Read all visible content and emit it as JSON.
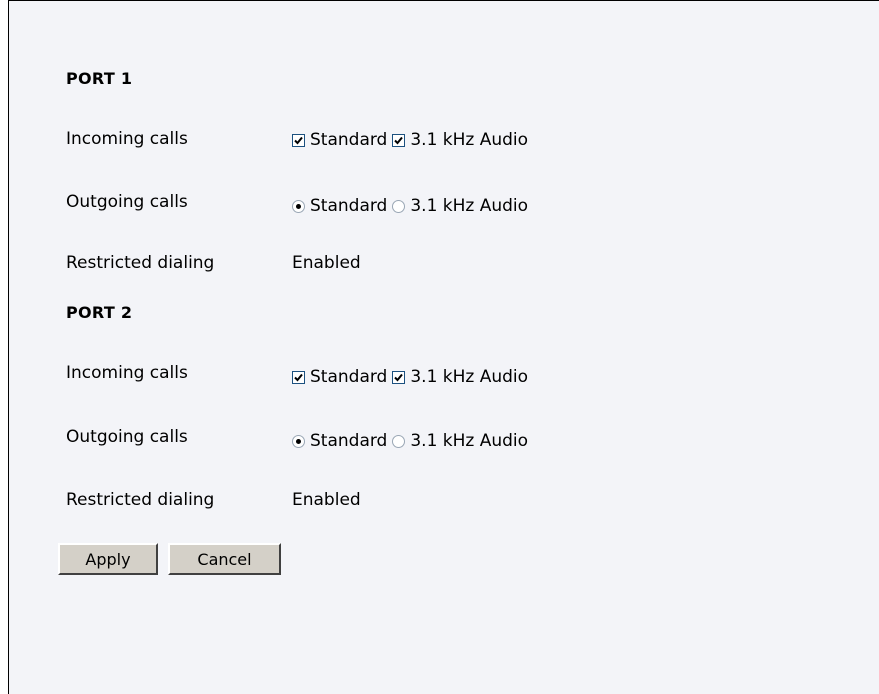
{
  "ports": [
    {
      "title": "PORT 1",
      "incoming": {
        "label": "Incoming calls",
        "options": [
          {
            "label": "Standard",
            "checked": true
          },
          {
            "label": "3.1 kHz Audio",
            "checked": true
          }
        ]
      },
      "outgoing": {
        "label": "Outgoing calls",
        "options": [
          {
            "label": "Standard",
            "selected": true
          },
          {
            "label": "3.1 kHz Audio",
            "selected": false
          }
        ]
      },
      "restricted": {
        "label": "Restricted dialing",
        "value": "Enabled"
      }
    },
    {
      "title": "PORT 2",
      "incoming": {
        "label": "Incoming calls",
        "options": [
          {
            "label": "Standard",
            "checked": true
          },
          {
            "label": "3.1 kHz Audio",
            "checked": true
          }
        ]
      },
      "outgoing": {
        "label": "Outgoing calls",
        "options": [
          {
            "label": "Standard",
            "selected": true
          },
          {
            "label": "3.1 kHz Audio",
            "selected": false
          }
        ]
      },
      "restricted": {
        "label": "Restricted dialing",
        "value": "Enabled"
      }
    }
  ],
  "buttons": {
    "apply": "Apply",
    "cancel": "Cancel"
  }
}
